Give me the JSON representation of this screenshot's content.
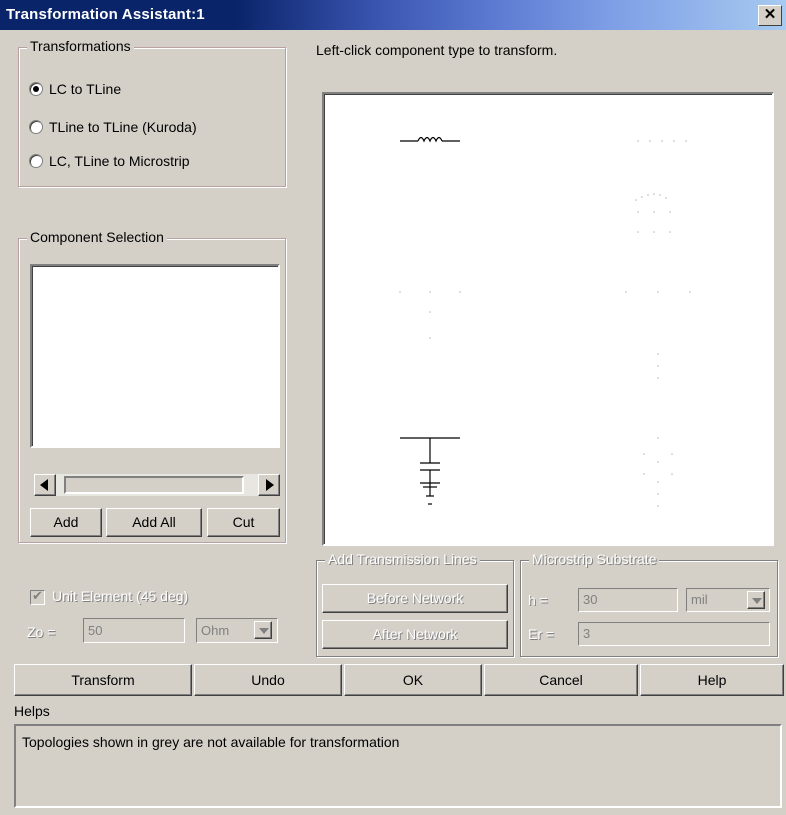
{
  "window": {
    "title": "Transformation Assistant:1",
    "close_glyph": "✕"
  },
  "transformations": {
    "title": "Transformations",
    "options": [
      {
        "label": "LC to TLine",
        "selected": true
      },
      {
        "label": "TLine to TLine (Kuroda)",
        "selected": false
      },
      {
        "label": "LC, TLine to Microstrip",
        "selected": false
      }
    ]
  },
  "instruction": "Left-click component type to transform.",
  "component_selection": {
    "title": "Component Selection",
    "buttons": {
      "add": "Add",
      "add_all": "Add All",
      "cut": "Cut"
    }
  },
  "unit_element": {
    "label": "Unit Element (45 deg)",
    "checked": true
  },
  "zo": {
    "label": "Zo =",
    "value": "50",
    "unit": "Ohm"
  },
  "add_tlines": {
    "title": "Add Transmission Lines",
    "before": "Before Network",
    "after": "After Network"
  },
  "microstrip": {
    "title": "Microstrip Substrate",
    "h_label": "h =",
    "h_value": "30",
    "h_unit": "mil",
    "er_label": "Er =",
    "er_value": "3"
  },
  "bottom_buttons": {
    "transform": "Transform",
    "undo": "Undo",
    "ok": "OK",
    "cancel": "Cancel",
    "help": "Help"
  },
  "helps": {
    "label": "Helps",
    "text": "Topologies shown in grey are not available for transformation"
  }
}
